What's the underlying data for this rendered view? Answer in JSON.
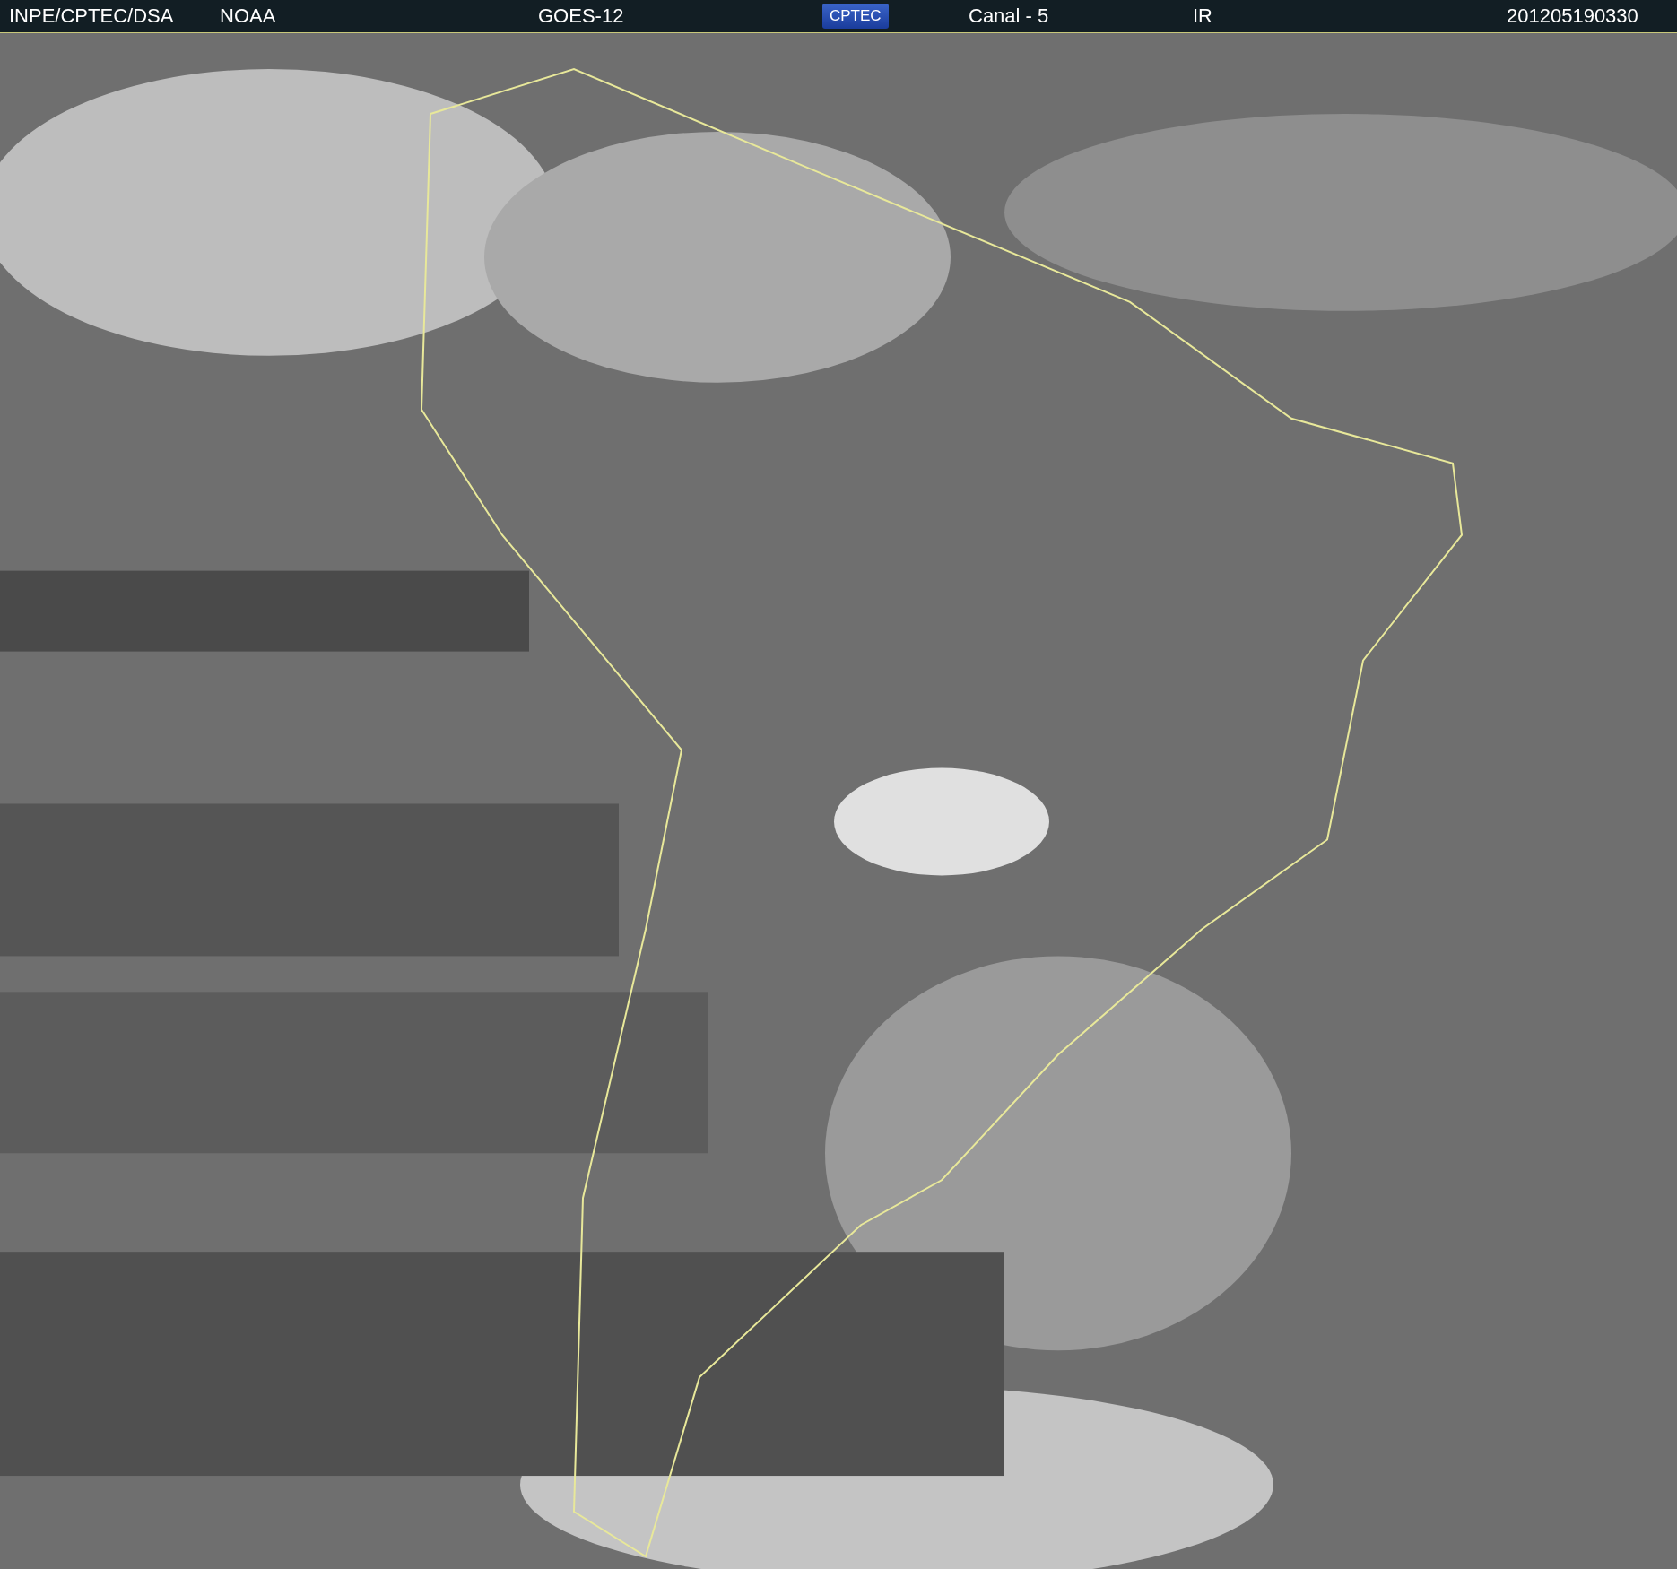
{
  "header": {
    "items": [
      {
        "kind": "text",
        "text": "INPE/CPTEC/DSA"
      },
      {
        "kind": "text",
        "text": "NOAA"
      },
      {
        "kind": "text",
        "text": "GOES-12"
      },
      {
        "kind": "logo",
        "text": "CPTEC"
      },
      {
        "kind": "text",
        "text": "Canal - 5"
      },
      {
        "kind": "text",
        "text": "IR"
      },
      {
        "kind": "text",
        "text": "201205190330"
      }
    ]
  }
}
